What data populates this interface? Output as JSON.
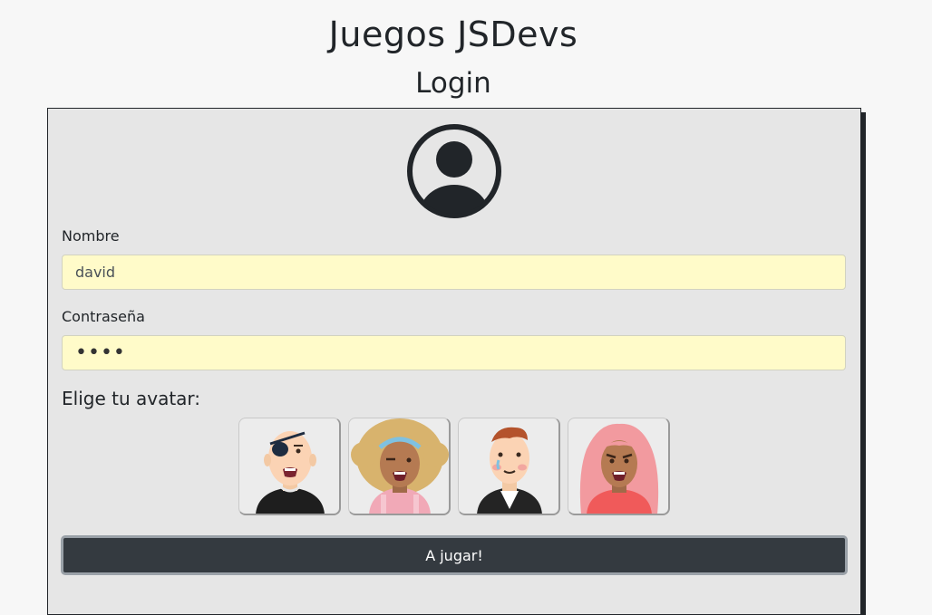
{
  "header": {
    "title": "Juegos JSDevs",
    "subtitle": "Login"
  },
  "form": {
    "user_icon": "user-circle-icon",
    "name_label": "Nombre",
    "name_value": "david",
    "password_label": "Contraseña",
    "password_value": "••••",
    "avatar_label": "Elige tu avatar:",
    "avatars": [
      {
        "name": "avatar-eyepatch-man"
      },
      {
        "name": "avatar-curly-hair-woman"
      },
      {
        "name": "avatar-red-hair-man"
      },
      {
        "name": "avatar-pink-hair-woman"
      }
    ],
    "submit_label": "A jugar!"
  },
  "colors": {
    "input_background": "#fffbc9",
    "button_background": "#343a40",
    "card_background": "#e6e6e6"
  }
}
